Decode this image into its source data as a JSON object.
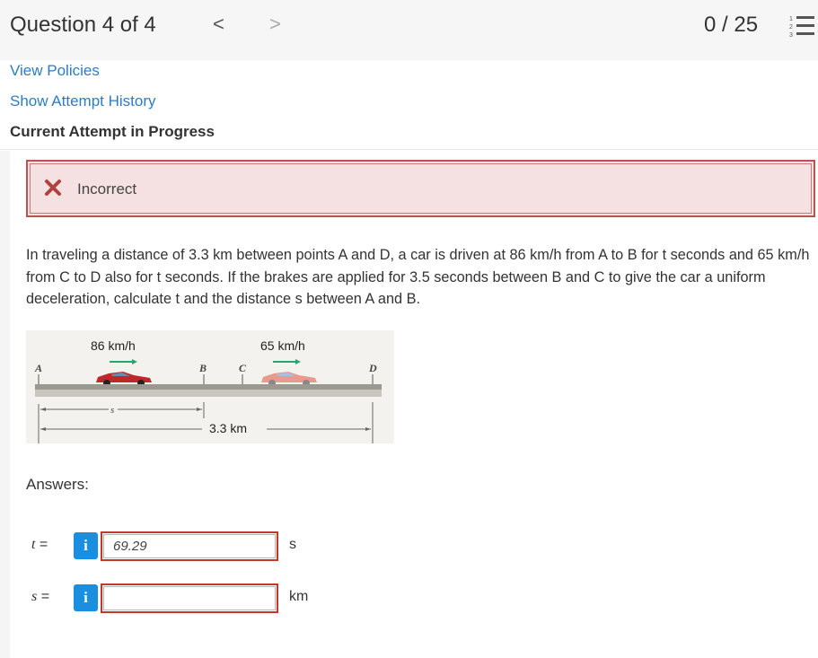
{
  "header": {
    "question_title": "Question 4 of 4",
    "prev_symbol": "<",
    "next_symbol": ">",
    "score": "0 / 25"
  },
  "links": {
    "view_policies": "View Policies",
    "show_attempt_history": "Show Attempt History"
  },
  "attempt_status": "Current Attempt in Progress",
  "feedback": {
    "status": "Incorrect",
    "color": "#b65353",
    "bg_color": "#f5e1e2"
  },
  "problem_text": "In traveling a distance of 3.3 km between points A and D, a car is driven at 86 km/h from A to B for t seconds and 65 km/h from C to D also for t seconds. If the brakes are applied for 3.5 seconds between B and C to give the car a uniform deceleration, calculate t and the distance s between A and B.",
  "figure": {
    "speed_1": "86 km/h",
    "speed_2": "65 km/h",
    "point_a": "A",
    "point_b": "B",
    "point_c": "C",
    "point_d": "D",
    "s_label": "s",
    "distance": "3.3 km"
  },
  "answers": {
    "label": "Answers:",
    "items": [
      {
        "var": "t",
        "eq": "=",
        "value": "69.29",
        "unit": "s"
      },
      {
        "var": "s",
        "eq": "=",
        "value": "",
        "unit": "km"
      }
    ]
  }
}
